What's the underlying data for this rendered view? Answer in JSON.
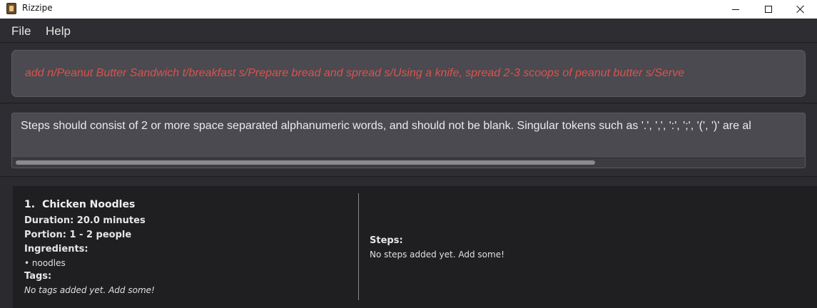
{
  "window": {
    "title": "Rizzipe",
    "icon": "recipe-book-icon"
  },
  "menu": {
    "file": "File",
    "help": "Help"
  },
  "command": {
    "value": "add n/Peanut Butter Sandwich t/breakfast s/Prepare bread and spread s/Using a knife, spread 2-3 scoops of peanut butter s/Serve",
    "error_color": "#d9534f"
  },
  "result": {
    "message": "Steps should consist of 2 or more space separated alphanumeric words, and should not be blank. Singular tokens such as '.', ',', ':', ';', '(', ')' are al"
  },
  "recipes": [
    {
      "index": "1.",
      "name": "Chicken Noodles",
      "duration": "Duration: 20.0 minutes",
      "portion": "Portion: 1 - 2 people",
      "ingredients_label": "Ingredients:",
      "ingredients": [
        "• noodles"
      ],
      "tags_label": "Tags:",
      "tags_empty": "No tags added yet. Add some!",
      "steps_label": "Steps:",
      "steps_empty": "No steps added yet. Add some!"
    }
  ]
}
